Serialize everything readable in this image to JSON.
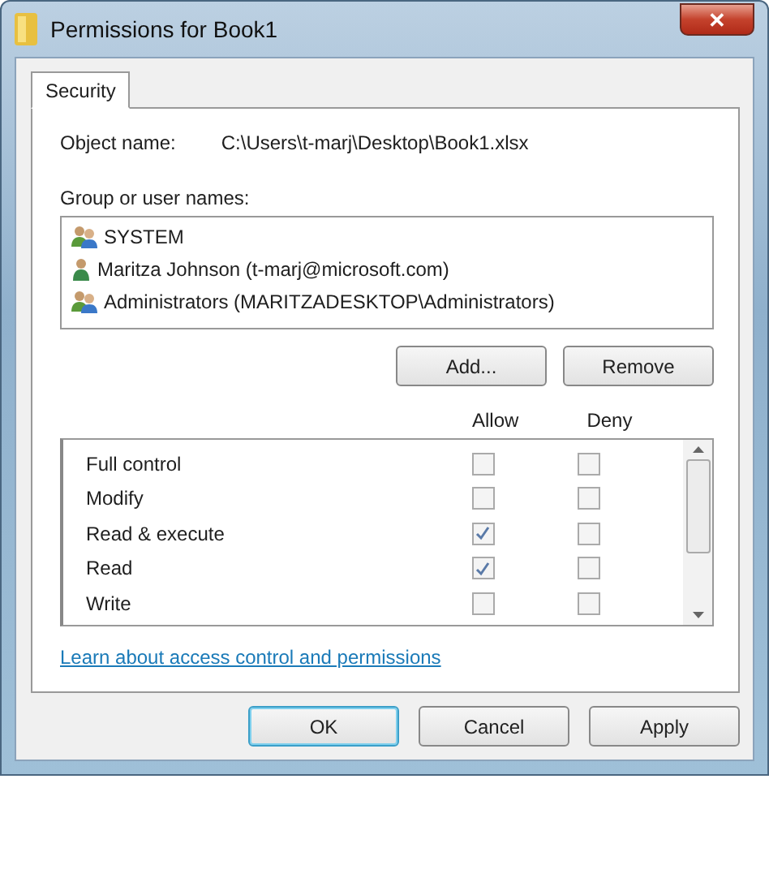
{
  "window": {
    "title": "Permissions for Book1",
    "close": "✕"
  },
  "tabs": [
    {
      "label": "Security",
      "selected": true
    }
  ],
  "object_name": {
    "label": "Object name:",
    "value": "C:\\Users\\t-marj\\Desktop\\Book1.xlsx"
  },
  "groups": {
    "label": "Group or user names:",
    "items": [
      {
        "name": "SYSTEM",
        "kind": "group",
        "selected": false
      },
      {
        "name": "Maritza Johnson (t-marj@microsoft.com)",
        "kind": "user",
        "selected": false
      },
      {
        "name": "Administrators (MARITZADESKTOP\\Administrators)",
        "kind": "group",
        "selected": false
      }
    ]
  },
  "group_buttons": [
    "Add...",
    "Remove"
  ],
  "permissions": {
    "columns": [
      "Allow",
      "Deny"
    ],
    "rows": [
      {
        "name": "Full control",
        "allow": false,
        "deny": false
      },
      {
        "name": "Modify",
        "allow": false,
        "deny": false
      },
      {
        "name": "Read & execute",
        "allow": true,
        "deny": false
      },
      {
        "name": "Read",
        "allow": true,
        "deny": false
      },
      {
        "name": "Write",
        "allow": false,
        "deny": false
      }
    ]
  },
  "link": "Learn about access control and permissions",
  "buttons": [
    {
      "label": "OK",
      "default": true
    },
    {
      "label": "Cancel",
      "default": false
    },
    {
      "label": "Apply",
      "default": false
    }
  ]
}
